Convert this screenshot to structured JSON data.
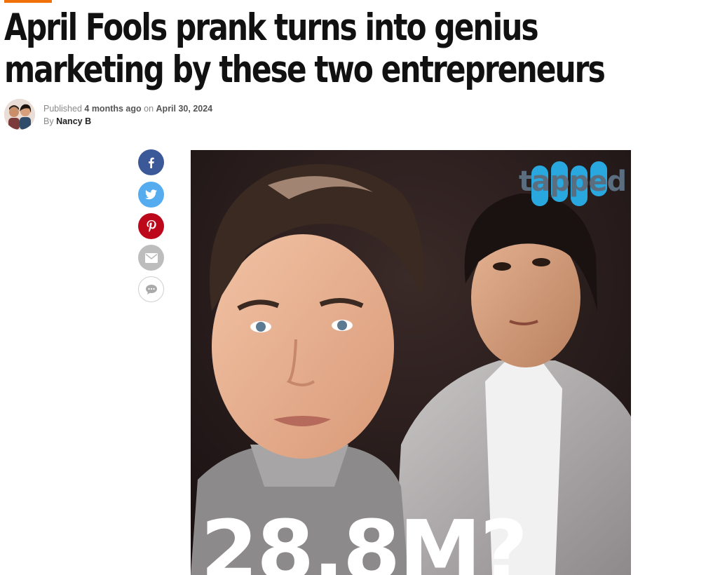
{
  "article": {
    "headline_line1": "April Fools prank turns into genius",
    "headline_line2": "marketing by these two entrepreneurs",
    "published_prefix": "Published",
    "published_relative": "4 months ago",
    "published_on": "on",
    "published_date": "April 30, 2024",
    "by_prefix": "By",
    "author": "Nancy B"
  },
  "share": {
    "items": [
      "facebook-icon",
      "twitter-icon",
      "pinterest-icon",
      "email-icon",
      "comment-icon"
    ]
  },
  "hero": {
    "logo_text": "tapped",
    "caption": "28.8M?"
  },
  "colors": {
    "accent": "#f0700a",
    "facebook": "#3b5998",
    "twitter": "#55acee",
    "pinterest": "#bd081c",
    "email": "#bdbdbd",
    "logo_blue": "#29a8e0"
  }
}
